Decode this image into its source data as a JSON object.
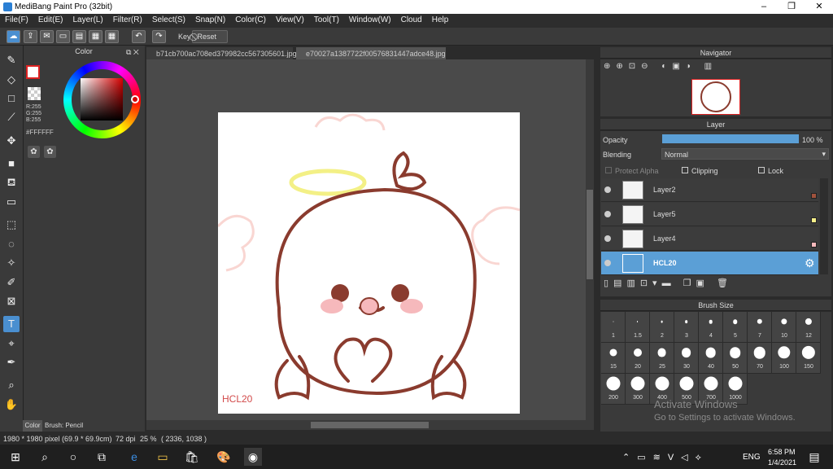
{
  "window": {
    "title": "MediBang Paint Pro (32bit)",
    "minimize": "–",
    "restore": "❐",
    "close": "✕"
  },
  "menu": [
    "File(F)",
    "Edit(E)",
    "Layer(L)",
    "Filter(R)",
    "Select(S)",
    "Snap(N)",
    "Color(C)",
    "View(V)",
    "Tool(T)",
    "Window(W)",
    "Cloud",
    "Help"
  ],
  "toolbar": {
    "key_label": "Key",
    "reset_label": "Reset"
  },
  "tabs": [
    "b71cb700ac708ed379982cc567305601.jpg",
    "e70027a1387722f00576831447adce48.jpg"
  ],
  "color_panel": {
    "title": "Color",
    "r": "R:255",
    "g": "G:255",
    "b": "B:255",
    "hex": "#FFFFFF",
    "accent": "#ffffff"
  },
  "canvas": {
    "watermark": "HCL20"
  },
  "bottom_left_tabs": {
    "color": "Color",
    "brush": "Brush: Pencil"
  },
  "status": {
    "size": "1980 * 1980 pixel",
    "cm": "(69.9 * 69.9cm)",
    "dpi": "72 dpi",
    "zoom": "25 %",
    "coords": "( 2336, 1038 )"
  },
  "navigator": {
    "title": "Navigator"
  },
  "layer_panel": {
    "title": "Layer",
    "opacity_label": "Opacity",
    "opacity_value": "100 %",
    "opacity": 1.0,
    "blending_label": "Blending",
    "blending_value": "Normal",
    "protect_alpha": "Protect Alpha",
    "clipping": "Clipping",
    "lock": "Lock",
    "layers": [
      {
        "name": "Layer2",
        "swatch": "#a0523d",
        "selected": false
      },
      {
        "name": "Layer5",
        "swatch": "#f7f08a",
        "selected": false
      },
      {
        "name": "Layer4",
        "swatch": "#f6b9bc",
        "selected": false
      },
      {
        "name": "HCL20",
        "swatch": "",
        "selected": true
      }
    ]
  },
  "brush_panel": {
    "title": "Brush Size",
    "sizes": [
      "1",
      "1.5",
      "2",
      "3",
      "4",
      "5",
      "7",
      "10",
      "12",
      "15",
      "20",
      "25",
      "30",
      "40",
      "50",
      "70",
      "100",
      "150",
      "200",
      "300",
      "400",
      "500",
      "700",
      "1000"
    ]
  },
  "watermark_os": {
    "line1": "Activate Windows",
    "line2": "Go to Settings to activate Windows."
  },
  "taskbar": {
    "lang": "ENG",
    "time": "6:58 PM",
    "date": "1/4/2021"
  }
}
